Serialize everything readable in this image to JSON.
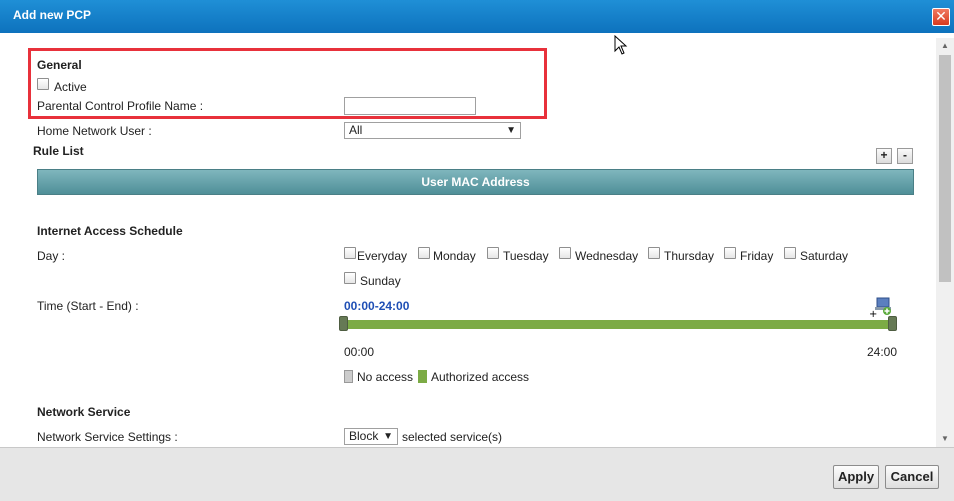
{
  "window": {
    "title": "Add new PCP"
  },
  "general": {
    "heading": "General",
    "active_label": "Active",
    "profile_name_label": "Parental Control Profile Name :",
    "profile_name_value": ""
  },
  "home_user": {
    "label": "Home Network User :",
    "selected": "All"
  },
  "rule_list": {
    "heading": "Rule List",
    "add_label": "+",
    "remove_label": "-",
    "column_header": "User MAC Address"
  },
  "schedule": {
    "heading": "Internet Access Schedule",
    "day_label": "Day :",
    "days": [
      "Everyday",
      "Monday",
      "Tuesday",
      "Wednesday",
      "Thursday",
      "Friday",
      "Saturday",
      "Sunday"
    ],
    "time_label": "Time (Start - End) :",
    "time_range": "00:00-24:00",
    "start_time": "00:00",
    "end_time": "24:00",
    "authorized_fraction": 1.0,
    "legend_no_access": "No access",
    "legend_authorized": "Authorized access",
    "colors": {
      "authorized": "#7cab45",
      "no_access": "#cccccc"
    }
  },
  "network_service": {
    "heading": "Network Service",
    "settings_label": "Network Service Settings :",
    "mode": "Block",
    "mode_suffix": "selected service(s)"
  },
  "footer": {
    "apply_label": "Apply",
    "cancel_label": "Cancel"
  }
}
